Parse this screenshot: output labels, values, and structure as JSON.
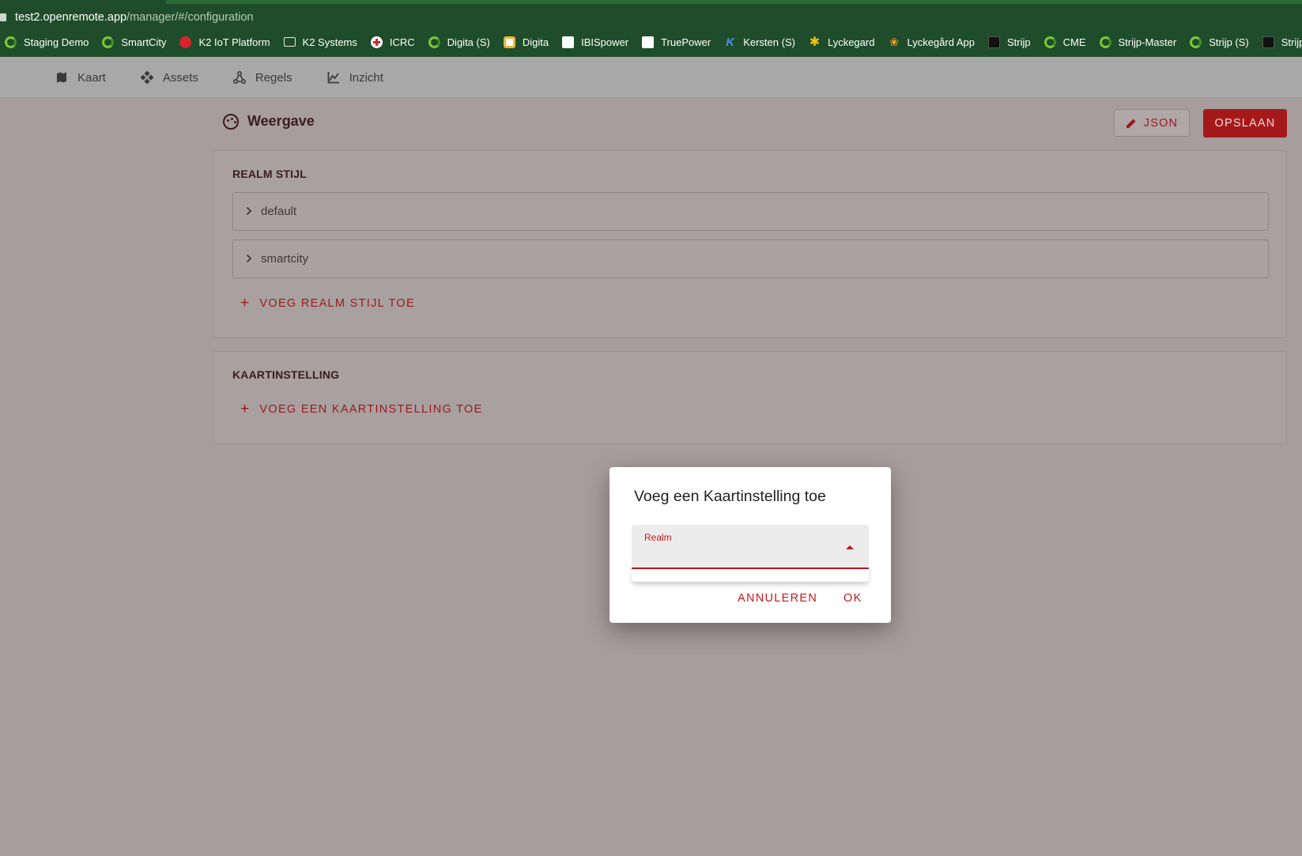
{
  "browser": {
    "url_host": "test2.openremote.app",
    "url_path": "/manager/#/configuration",
    "bookmarks": [
      {
        "label": "Staging Demo",
        "icon": "ring-icon"
      },
      {
        "label": "SmartCity",
        "icon": "ring-icon"
      },
      {
        "label": "K2 IoT Platform",
        "icon": "k2-icon"
      },
      {
        "label": "K2 Systems",
        "icon": "folder-icon"
      },
      {
        "label": "ICRC",
        "icon": "cross-icon"
      },
      {
        "label": "Digita (S)",
        "icon": "ring-icon"
      },
      {
        "label": "Digita",
        "icon": "digita-icon"
      },
      {
        "label": "IBISpower",
        "icon": "ibis-icon"
      },
      {
        "label": "TruePower",
        "icon": "ibis-icon"
      },
      {
        "label": "Kersten (S)",
        "icon": "k-icon"
      },
      {
        "label": "Lyckegard",
        "icon": "star-icon"
      },
      {
        "label": "Lyckegård App",
        "icon": "app-icon"
      },
      {
        "label": "Strijp",
        "icon": "black-icon"
      },
      {
        "label": "CME",
        "icon": "ring-icon"
      },
      {
        "label": "Strijp-Master",
        "icon": "ring-icon"
      },
      {
        "label": "Strijp (S)",
        "icon": "ring-icon"
      },
      {
        "label": "Strijp-Master",
        "icon": "black-icon"
      }
    ]
  },
  "nav": {
    "items": [
      {
        "label": "Kaart",
        "icon": "map-icon"
      },
      {
        "label": "Assets",
        "icon": "assets-icon"
      },
      {
        "label": "Regels",
        "icon": "rules-icon"
      },
      {
        "label": "Inzicht",
        "icon": "insights-icon"
      }
    ]
  },
  "page": {
    "title": "Weergave",
    "json_label": "JSON",
    "save_label": "OPSLAAN"
  },
  "realm_style": {
    "title": "REALM STIJL",
    "items": [
      "default",
      "smartcity"
    ],
    "add_label": "VOEG REALM STIJL TOE"
  },
  "map_settings": {
    "title": "KAARTINSTELLING",
    "add_label": "VOEG EEN KAARTINSTELLING TOE"
  },
  "dialog": {
    "title": "Voeg een Kaartinstelling toe",
    "select_label": "Realm",
    "select_value": "",
    "cancel_label": "ANNULEREN",
    "ok_label": "OK"
  },
  "colors": {
    "accent": "#c1191d",
    "browser_chrome": "#1f4d2b",
    "overlay": "#a89d9d"
  }
}
